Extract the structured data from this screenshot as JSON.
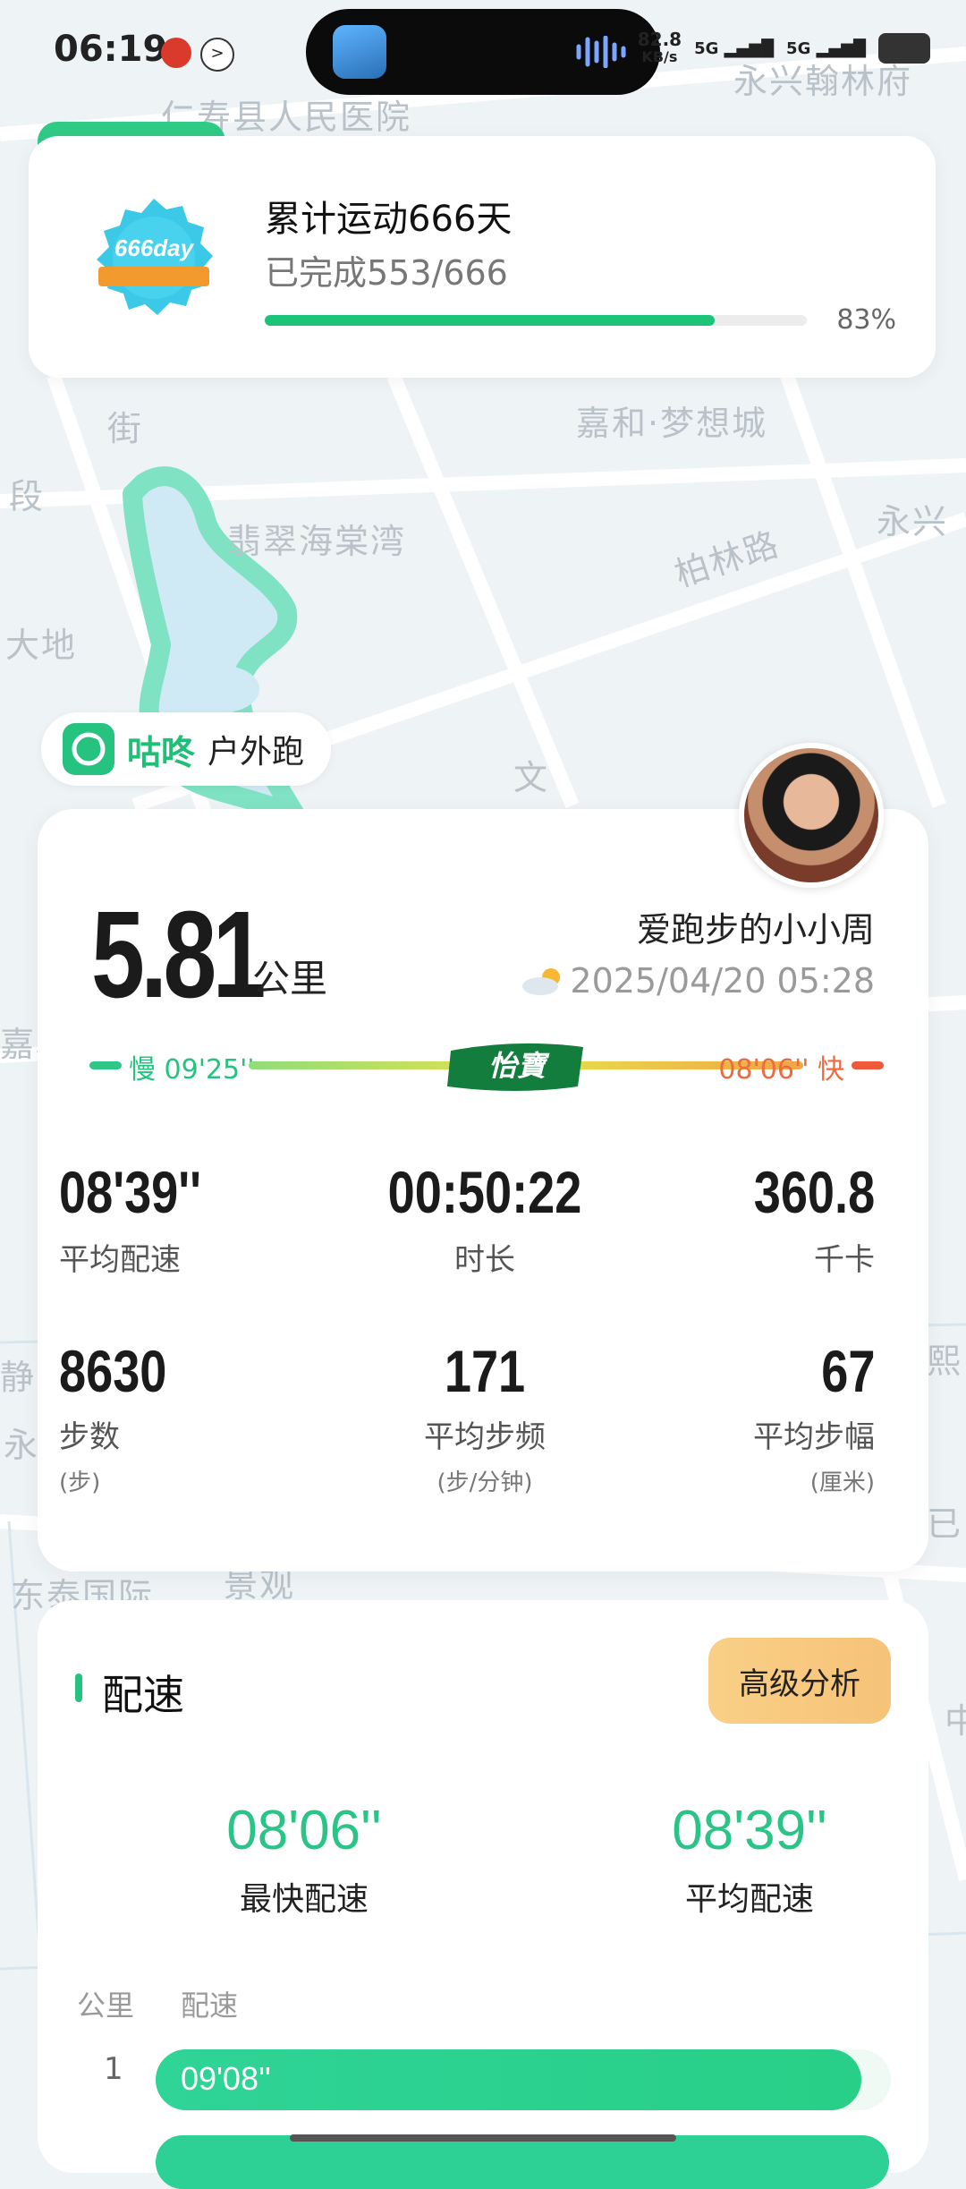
{
  "status_bar": {
    "time": "06:19",
    "net_speed_value": "82.8",
    "net_speed_unit": "KB/s",
    "signal1": "5G",
    "signal2": "5G"
  },
  "map_labels": [
    "仁寿县人民医院",
    "永兴翰林府",
    "嘉和·梦想城",
    "翡翠海棠湾",
    "柏林路",
    "永兴",
    "大地",
    "段",
    "街",
    "文",
    "静",
    "永",
    "东泰国际",
    "景观",
    "嘉和",
    "熙",
    "已",
    "中"
  ],
  "achievement": {
    "title": "累计运动666天",
    "progress_text": "已完成553/666",
    "percent_label": "83%",
    "progress_fraction": 0.83,
    "badge_text": "666day"
  },
  "brand": {
    "name": "咕咚",
    "activity_type": "户外跑"
  },
  "run": {
    "distance": "5.81",
    "distance_unit": "公里",
    "username": "爱跑步的小小周",
    "datetime": "2025/04/20 05:28",
    "slow_pace": "慢 09'25''",
    "fast_pace": "08'06'' 快",
    "sponsor": "怡寶"
  },
  "stats": [
    {
      "value": "08'39''",
      "label": "平均配速",
      "unit": ""
    },
    {
      "value": "00:50:22",
      "label": "时长",
      "unit": ""
    },
    {
      "value": "360.8",
      "label": "千卡",
      "unit": ""
    },
    {
      "value": "8630",
      "label": "步数",
      "unit": "(步)"
    },
    {
      "value": "171",
      "label": "平均步频",
      "unit": "(步/分钟)"
    },
    {
      "value": "67",
      "label": "平均步幅",
      "unit": "(厘米)"
    }
  ],
  "pace_section": {
    "title": "配速",
    "advanced_button": "高级分析",
    "fastest_value": "08'06''",
    "fastest_label": "最快配速",
    "average_value": "08'39''",
    "average_label": "平均配速",
    "col_km": "公里",
    "col_pace": "配速",
    "rows": [
      {
        "km": "1",
        "pace": "09'08''",
        "bar_fraction": 0.96
      }
    ]
  },
  "colors": {
    "accent_green": "#25c37f",
    "fast_orange": "#ef6a3c",
    "button_gold": "#f7c97f"
  }
}
